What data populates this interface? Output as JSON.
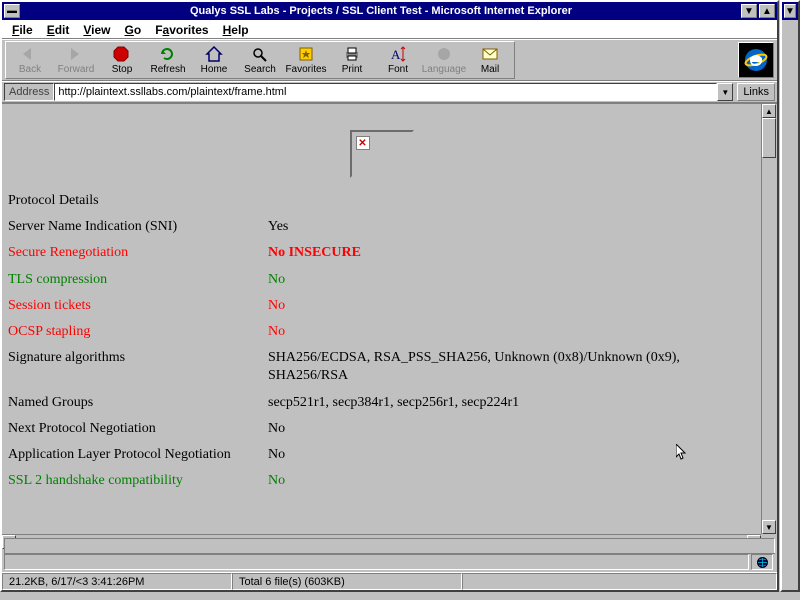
{
  "window": {
    "title": "Qualys SSL Labs - Projects / SSL Client Test - Microsoft Internet Explorer"
  },
  "menubar": [
    "File",
    "Edit",
    "View",
    "Go",
    "Favorites",
    "Help"
  ],
  "toolbar": [
    {
      "name": "back",
      "label": "Back",
      "disabled": true
    },
    {
      "name": "forward",
      "label": "Forward",
      "disabled": true
    },
    {
      "name": "stop",
      "label": "Stop",
      "disabled": false
    },
    {
      "name": "refresh",
      "label": "Refresh",
      "disabled": false
    },
    {
      "name": "home",
      "label": "Home",
      "disabled": false
    },
    {
      "name": "search",
      "label": "Search",
      "disabled": false
    },
    {
      "name": "favorites",
      "label": "Favorites",
      "disabled": false
    },
    {
      "name": "print",
      "label": "Print",
      "disabled": false
    },
    {
      "name": "font",
      "label": "Font",
      "disabled": false
    },
    {
      "name": "language",
      "label": "Language",
      "disabled": true
    },
    {
      "name": "mail",
      "label": "Mail",
      "disabled": false
    }
  ],
  "addressbar": {
    "label": "Address",
    "url": "http://plaintext.ssllabs.com/plaintext/frame.html",
    "links": "Links"
  },
  "page": {
    "heading": "Protocol Details",
    "rows": [
      {
        "label": "Server Name Indication (SNI)",
        "value": "Yes",
        "labelClass": "",
        "valClass": ""
      },
      {
        "label": "Secure Renegotiation",
        "value": "No   INSECURE",
        "labelClass": "red",
        "valClass": "red bold"
      },
      {
        "label": "TLS compression",
        "value": "No",
        "labelClass": "green",
        "valClass": "green"
      },
      {
        "label": "Session tickets",
        "value": "No",
        "labelClass": "red",
        "valClass": "red"
      },
      {
        "label": "OCSP stapling",
        "value": "No",
        "labelClass": "red",
        "valClass": "red"
      },
      {
        "label": "Signature algorithms",
        "value": "SHA256/ECDSA, RSA_PSS_SHA256, Unknown (0x8)/Unknown (0x9), SHA256/RSA",
        "labelClass": "",
        "valClass": ""
      },
      {
        "label": "Named Groups",
        "value": "secp521r1, secp384r1, secp256r1, secp224r1",
        "labelClass": "",
        "valClass": ""
      },
      {
        "label": "Next Protocol Negotiation",
        "value": "No",
        "labelClass": "",
        "valClass": ""
      },
      {
        "label": "Application Layer Protocol Negotiation",
        "value": "No",
        "labelClass": "",
        "valClass": ""
      },
      {
        "label": "SSL 2 handshake compatibility",
        "value": "No",
        "labelClass": "green",
        "valClass": "green"
      }
    ]
  },
  "taskbar": {
    "left": "21.2KB, 6/17/<3 3:41:26PM",
    "right": "Total 6 file(s) (603KB)"
  }
}
